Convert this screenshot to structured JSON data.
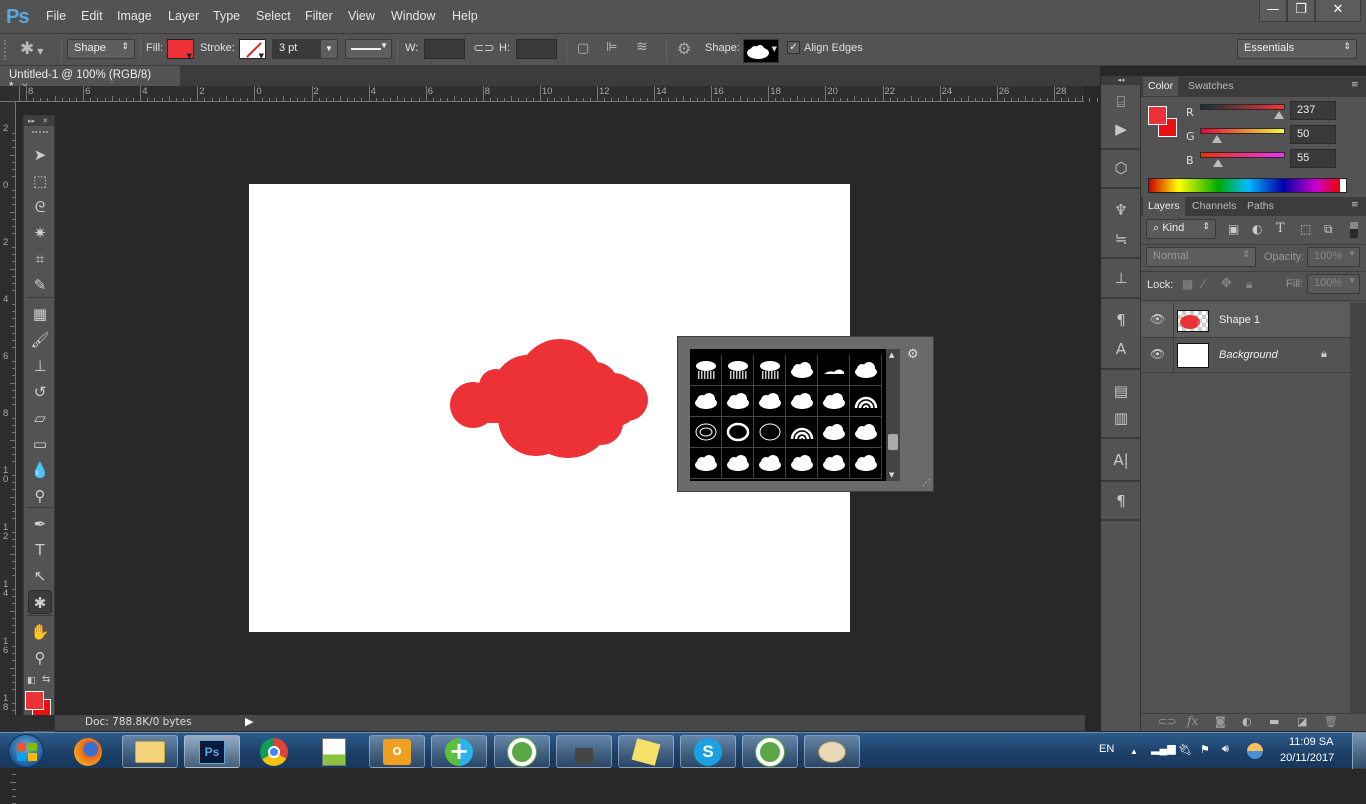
{
  "app": {
    "logo": "Ps",
    "accent": "#5aa6e0"
  },
  "menu": [
    "File",
    "Edit",
    "Image",
    "Layer",
    "Type",
    "Select",
    "Filter",
    "View",
    "Window",
    "Help"
  ],
  "window_controls": {
    "minimize": "—",
    "restore": "❐",
    "close": "✕"
  },
  "options": {
    "tool_mode": "Shape",
    "fill_label": "Fill:",
    "fill_color": "#ED3237",
    "stroke_label": "Stroke:",
    "stroke_size": "3 pt",
    "w_label": "W:",
    "w_value": "",
    "h_label": "H:",
    "h_value": "",
    "shape_label": "Shape:",
    "align_edges_label": "Align Edges",
    "align_edges_checked": true,
    "workspace": "Essentials"
  },
  "document": {
    "tab_title": "Untitled-1 @ 100% (RGB/8) *",
    "close_icon": "×",
    "shape_color": "#ED3237",
    "status": "Doc: 788.8K/0 bytes"
  },
  "rulers": {
    "horizontal": [
      "8",
      "6",
      "4",
      "2",
      "0",
      "2",
      "4",
      "6",
      "8",
      "10",
      "12",
      "14",
      "16",
      "18",
      "20",
      "22",
      "24",
      "26",
      "28"
    ],
    "vertical": [
      "2",
      "0",
      "2",
      "4",
      "6",
      "8",
      "10",
      "12",
      "14",
      "16",
      "18",
      "10"
    ]
  },
  "toolbox": {
    "tools": [
      {
        "name": "move-tool",
        "glyph": "➤"
      },
      {
        "name": "marquee-tool",
        "glyph": "⬚"
      },
      {
        "name": "lasso-tool",
        "glyph": "ᘓ"
      },
      {
        "name": "magic-wand-tool",
        "glyph": "✷"
      },
      {
        "name": "crop-tool",
        "glyph": "⌗"
      },
      {
        "name": "eyedropper-tool",
        "glyph": "✎"
      },
      {
        "name": "healing-brush-tool",
        "glyph": "▦"
      },
      {
        "name": "brush-tool",
        "glyph": "🖌"
      },
      {
        "name": "clone-stamp-tool",
        "glyph": "⊥"
      },
      {
        "name": "history-brush-tool",
        "glyph": "↺"
      },
      {
        "name": "eraser-tool",
        "glyph": "▱"
      },
      {
        "name": "gradient-tool",
        "glyph": "▭"
      },
      {
        "name": "blur-tool",
        "glyph": "💧"
      },
      {
        "name": "dodge-tool",
        "glyph": "⚲"
      },
      {
        "name": "pen-tool",
        "glyph": "✒"
      },
      {
        "name": "type-tool",
        "glyph": "T"
      },
      {
        "name": "path-selection-tool",
        "glyph": "↖"
      },
      {
        "name": "custom-shape-tool",
        "glyph": "✱",
        "active": true
      },
      {
        "name": "hand-tool",
        "glyph": "✋"
      },
      {
        "name": "zoom-tool",
        "glyph": "⚲"
      }
    ],
    "foreground_color": "#ED3237",
    "background_color": "#E81010"
  },
  "shape_picker": {
    "shapes": [
      "cloud-rain",
      "cloud-rain-heavy",
      "cloud-snow",
      "cloud-2",
      "cloud-flat",
      "cloud-3",
      "cloud-4",
      "cloud-5",
      "cloud-6",
      "cloud-7",
      "cloud-8",
      "rainbow",
      "cloud-outline-swirl",
      "cloud-outline-thick",
      "cloud-outline-thin",
      "rainbow-2",
      "cloud-bubbles",
      "cloud-9",
      "cloud-10",
      "cloud-11",
      "cloud-12",
      "cloud-13",
      "cloud-14",
      "cloud-15"
    ],
    "settings_icon": "⚙"
  },
  "color_panel": {
    "tabs": [
      "Color",
      "Swatches"
    ],
    "active_tab": "Color",
    "channels": [
      {
        "label": "R",
        "value": "237",
        "fraction": 0.93
      },
      {
        "label": "G",
        "value": "50",
        "fraction": 0.196
      },
      {
        "label": "B",
        "value": "55",
        "fraction": 0.216
      }
    ],
    "foreground": "#ED3237",
    "background": "#E81010"
  },
  "layers_panel": {
    "tabs": [
      "Layers",
      "Channels",
      "Paths"
    ],
    "active_tab": "Layers",
    "filter": "Kind",
    "blend_mode": "Normal",
    "opacity_label": "Opacity:",
    "opacity": "100%",
    "lock_label": "Lock:",
    "fill_label": "Fill:",
    "fill": "100%",
    "layers": [
      {
        "name": "Shape 1",
        "visible": true,
        "selected": true
      },
      {
        "name": "Background",
        "visible": true,
        "locked": true
      }
    ]
  },
  "taskbar": {
    "apps": [
      "start",
      "firefox",
      "file-explorer",
      "photoshop",
      "chrome",
      "notepad-plus-plus",
      "outlook",
      "add-app",
      "coccoc",
      "vpn-lock",
      "sticky-notes",
      "skype",
      "coccoc-2",
      "paint"
    ],
    "language": "EN",
    "time": "11:09 SA",
    "date": "20/11/2017"
  }
}
